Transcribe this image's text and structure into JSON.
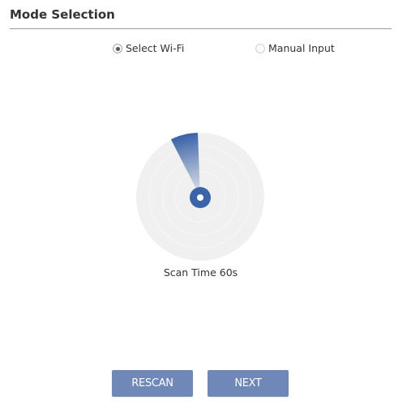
{
  "header": {
    "title": "Mode Selection"
  },
  "mode_options": [
    {
      "label": "Select Wi-Fi",
      "checked": true
    },
    {
      "label": "Manual Input",
      "checked": false
    }
  ],
  "scan": {
    "label": "Scan Time 60s",
    "radar_color": "#3c64a8",
    "radar_background": "#f0f0f0"
  },
  "actions": {
    "rescan_label": "RESCAN",
    "next_label": "NEXT",
    "button_color": "#7088b8"
  }
}
